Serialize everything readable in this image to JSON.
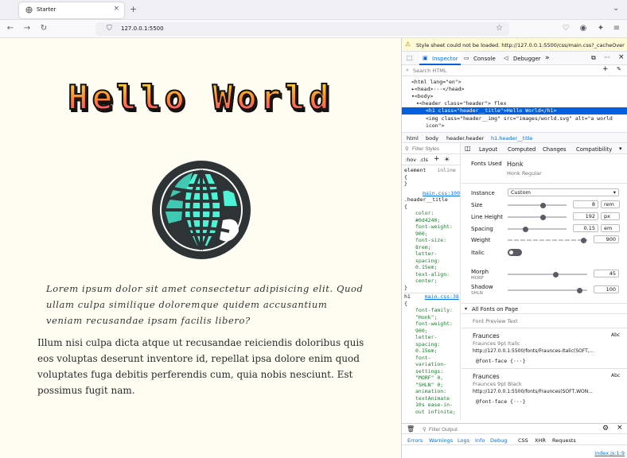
{
  "browser": {
    "tab_title": "Starter",
    "url": "127.0.0.1:5500",
    "new_tab": "+"
  },
  "page": {
    "heading": "Hello World",
    "quote": "Lorem ipsum dolor sit amet consectetur adipisicing elit. Quod ullam culpa similique doloremque quidem accusantium veniam recusandae ipsam facilis libero?",
    "body": "Illum nisi culpa dicta atque ut recusandae reiciendis doloribus quis eos voluptas deserunt inventore id, repellat ipsa dolore enim quod voluptates fuga debitis perferendis cum, quia nobis nesciunt. Est possimus fugit nam."
  },
  "devtools": {
    "warning": "Style sheet could not be loaded. http://127.0.0.1:5500/css/main.css?_cacheOver...",
    "tabs": [
      "Inspector",
      "Console",
      "Debugger"
    ],
    "search_placeholder": "Search HTML",
    "html_tree": [
      {
        "text": "<html lang=\"en\">"
      },
      {
        "text": "▸<head>···</head>"
      },
      {
        "text": "▾<body>"
      },
      {
        "text": "▾<header class=\"header\"> flex"
      },
      {
        "text": "<h1 class=\"header__title\">Hello World</h1>"
      },
      {
        "text": "<img class=\"header__img\" src=\"images/world.svg\" alt=\"a world"
      },
      {
        "text": "icon\">"
      }
    ],
    "breadcrumbs": [
      "html",
      "body",
      "header.header",
      "h1.header__title"
    ],
    "rules": {
      "filter_placeholder": "Filter Styles",
      "pseudo": ":hov",
      "cls": ".cls",
      "element_label": "element",
      "element_inline": "inline",
      "source1": "main.css:100",
      "selector1": ".header__title",
      "decls1": [
        "color: #0d4240;",
        "font-weight: 900;",
        "font-size: 8rem;",
        "letter-spacing: 0.15em;",
        "text-align: center;"
      ],
      "source2": "main.css:38",
      "selector2": "h1",
      "decls2": [
        "font-family: \"Honk\";",
        "font-weight: 900;",
        "letter-spacing: 0.15em;",
        "font-variation-settings: \"MORF\" 0, \"SHLN\" 0;",
        "animation: textAnimate 10s ease-in-out infinite;"
      ]
    },
    "layout_tabs": [
      "Layout",
      "Computed",
      "Changes",
      "Compatibility"
    ],
    "fonts": {
      "fonts_used_label": "Fonts Used",
      "font_name": "Honk",
      "font_sub": "Honk Regular",
      "instance_label": "Instance",
      "instance_value": "Custom",
      "size_label": "Size",
      "size_value": "8",
      "size_unit": "rem",
      "size_level": 0.6,
      "lineheight_label": "Line Height",
      "lineheight_value": "192",
      "lineheight_unit": "px",
      "lineheight_level": 0.6,
      "spacing_label": "Spacing",
      "spacing_value": "0.15",
      "spacing_unit": "em",
      "spacing_level": 0.3,
      "weight_label": "Weight",
      "weight_value": "900",
      "weight_level": 0.95,
      "italic_label": "Italic",
      "morph_label": "Morph",
      "morph_sub": "MORF",
      "morph_value": "45",
      "morph_level": 0.6,
      "shadow_label": "Shadow",
      "shadow_sub": "SHLN",
      "shadow_value": "100",
      "shadow_level": 0.9,
      "all_fonts_label": "All Fonts on Page",
      "preview_label": "Font Preview Text",
      "list": [
        {
          "name": "Fraunces",
          "detail": "Fraunces 9pt Italic",
          "url": "http://127.0.0.1:5500/fonts/Fraunces-Italic(SOFT,...",
          "rule": "@font-face {···}",
          "sample": "Abc"
        },
        {
          "name": "Fraunces",
          "detail": "Fraunces 9pt Black",
          "url": "http://127.0.0.1:5500/fonts/Fraunces(SOFT,WON...",
          "rule": "@font-face {···}",
          "sample": "Abc"
        }
      ]
    },
    "console": {
      "filter_placeholder": "Filter Output",
      "filters": [
        "Errors",
        "Warnings",
        "Logs",
        "Info",
        "Debug"
      ],
      "others": [
        "CSS",
        "XHR",
        "Requests"
      ],
      "source": "index.js:1:9"
    }
  },
  "colors": {
    "accent": "#0060df",
    "page_bg": "#fffdf1",
    "globe_dark": "#2e3436",
    "globe_cyan": "#4ef2d6"
  }
}
